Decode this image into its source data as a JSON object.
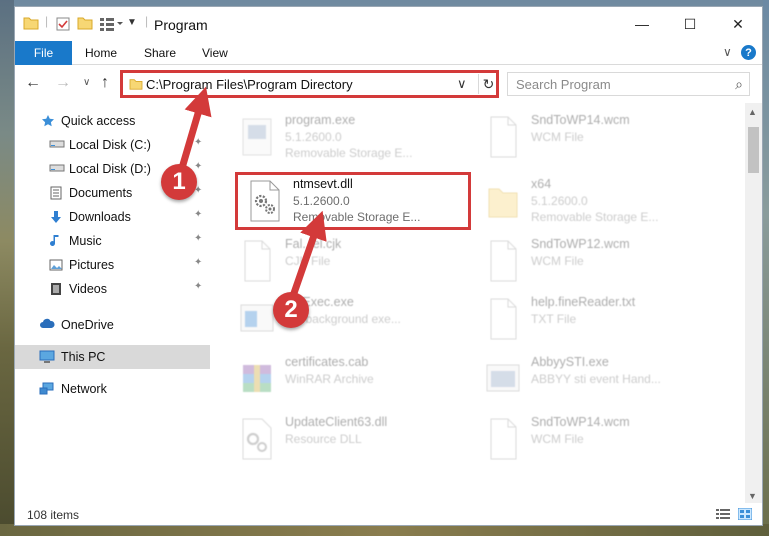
{
  "window": {
    "title": "Program",
    "min_glyph": "—",
    "max_glyph": "☐",
    "close_glyph": "✕"
  },
  "ribbon": {
    "tabs": [
      "File",
      "Home",
      "Share",
      "View"
    ],
    "expand_glyph": "∨",
    "help_glyph": "?"
  },
  "nav": {
    "back_glyph": "←",
    "forward_glyph": "→",
    "recent_glyph": "∨",
    "up_glyph": "↑"
  },
  "address": {
    "path": "C:\\Program Files\\Program Directory",
    "dropdown_glyph": "∨",
    "refresh_glyph": "↻"
  },
  "search": {
    "placeholder": "Search Program",
    "icon_glyph": "⌕"
  },
  "sidebar": {
    "items": [
      {
        "label": "Quick access",
        "icon": "star-icon"
      },
      {
        "label": "Local Disk (C:)",
        "icon": "drive-icon",
        "pinned": true
      },
      {
        "label": "Local Disk (D:)",
        "icon": "drive-icon",
        "pinned": true
      },
      {
        "label": "Documents",
        "icon": "documents-icon",
        "pinned": true
      },
      {
        "label": "Downloads",
        "icon": "download-icon",
        "pinned": true
      },
      {
        "label": "Music",
        "icon": "music-icon",
        "pinned": true
      },
      {
        "label": "Pictures",
        "icon": "pictures-icon",
        "pinned": true
      },
      {
        "label": "Videos",
        "icon": "videos-icon",
        "pinned": true
      },
      {
        "label": "OneDrive",
        "icon": "cloud-icon"
      },
      {
        "label": "This PC",
        "icon": "computer-icon"
      },
      {
        "label": "Network",
        "icon": "network-icon"
      }
    ],
    "pin_glyph": "✦"
  },
  "files": [
    {
      "name": "program.exe",
      "meta1": "5.1.2600.0",
      "meta2": "Removable Storage E...",
      "icon": "exe-icon"
    },
    {
      "name": "SndToWP14.wcm",
      "meta1": "WCM File",
      "meta2": "",
      "icon": "file-icon"
    },
    {
      "name": "ntmsevt.dll",
      "meta1": "5.1.2600.0",
      "meta2": "Removable Storage E...",
      "icon": "dll-gear-icon"
    },
    {
      "name": "x64",
      "meta1": "5.1.2600.0",
      "meta2": "Removable Storage E...",
      "icon": "folder-icon"
    },
    {
      "name": "Fal...el.cjk",
      "meta1": "CJK File",
      "meta2": "",
      "icon": "file-icon"
    },
    {
      "name": "SndToWP12.wcm",
      "meta1": "WCM File",
      "meta2": "",
      "icon": "file-icon"
    },
    {
      "name": "...eExec.exe",
      "meta1": "...T background exe...",
      "meta2": "",
      "icon": "exe-window-icon"
    },
    {
      "name": "help.fineReader.txt",
      "meta1": "TXT File",
      "meta2": "",
      "icon": "file-icon"
    },
    {
      "name": "certificates.cab",
      "meta1": "WinRAR Archive",
      "meta2": "",
      "icon": "archive-icon"
    },
    {
      "name": "AbbyySTI.exe",
      "meta1": "ABBYY sti event Hand...",
      "meta2": "",
      "icon": "exe-window-icon"
    },
    {
      "name": "UpdateClient63.dll",
      "meta1": "Resource DLL",
      "meta2": "",
      "icon": "dll-gear-icon"
    },
    {
      "name": "SndToWP14.wcm",
      "meta1": "WCM File",
      "meta2": "",
      "icon": "file-icon"
    }
  ],
  "status": {
    "item_count": "108 items"
  },
  "annotations": {
    "step1": "1",
    "step2": "2",
    "color": "#d33a3a"
  },
  "colors": {
    "accent": "#1979ca",
    "highlight": "#d33a3a",
    "selected_nav": "#d9d9d9"
  }
}
